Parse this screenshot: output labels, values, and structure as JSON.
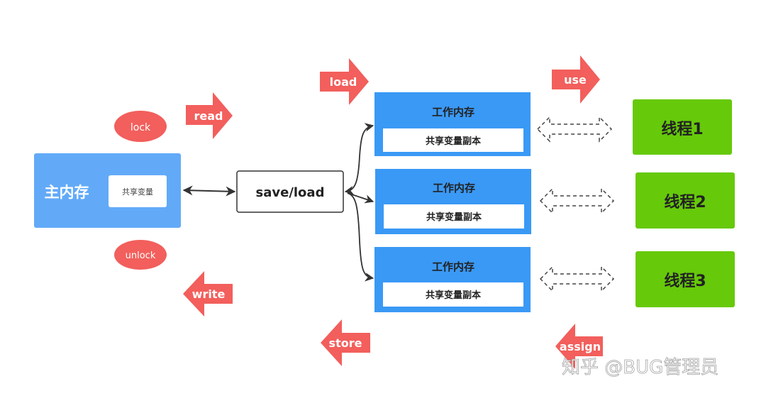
{
  "colors": {
    "main_memory": "#62aaf8",
    "working_memory": "#3a99f5",
    "thread": "#66c90a",
    "operation": "#f25f5c",
    "connector": "#333333"
  },
  "main_memory": {
    "title": "主内存",
    "variable": "共享变量"
  },
  "operations": {
    "lock": "lock",
    "unlock": "unlock",
    "read": "read",
    "write": "write",
    "load": "load",
    "store": "store",
    "use": "use",
    "assign": "assign"
  },
  "save_load": "save/load",
  "working_memories": [
    {
      "title": "工作内存",
      "copy": "共享变量副本"
    },
    {
      "title": "工作内存",
      "copy": "共享变量副本"
    },
    {
      "title": "工作内存",
      "copy": "共享变量副本"
    }
  ],
  "threads": [
    "线程1",
    "线程2",
    "线程3"
  ],
  "watermark": "知乎 @BUG管理员"
}
